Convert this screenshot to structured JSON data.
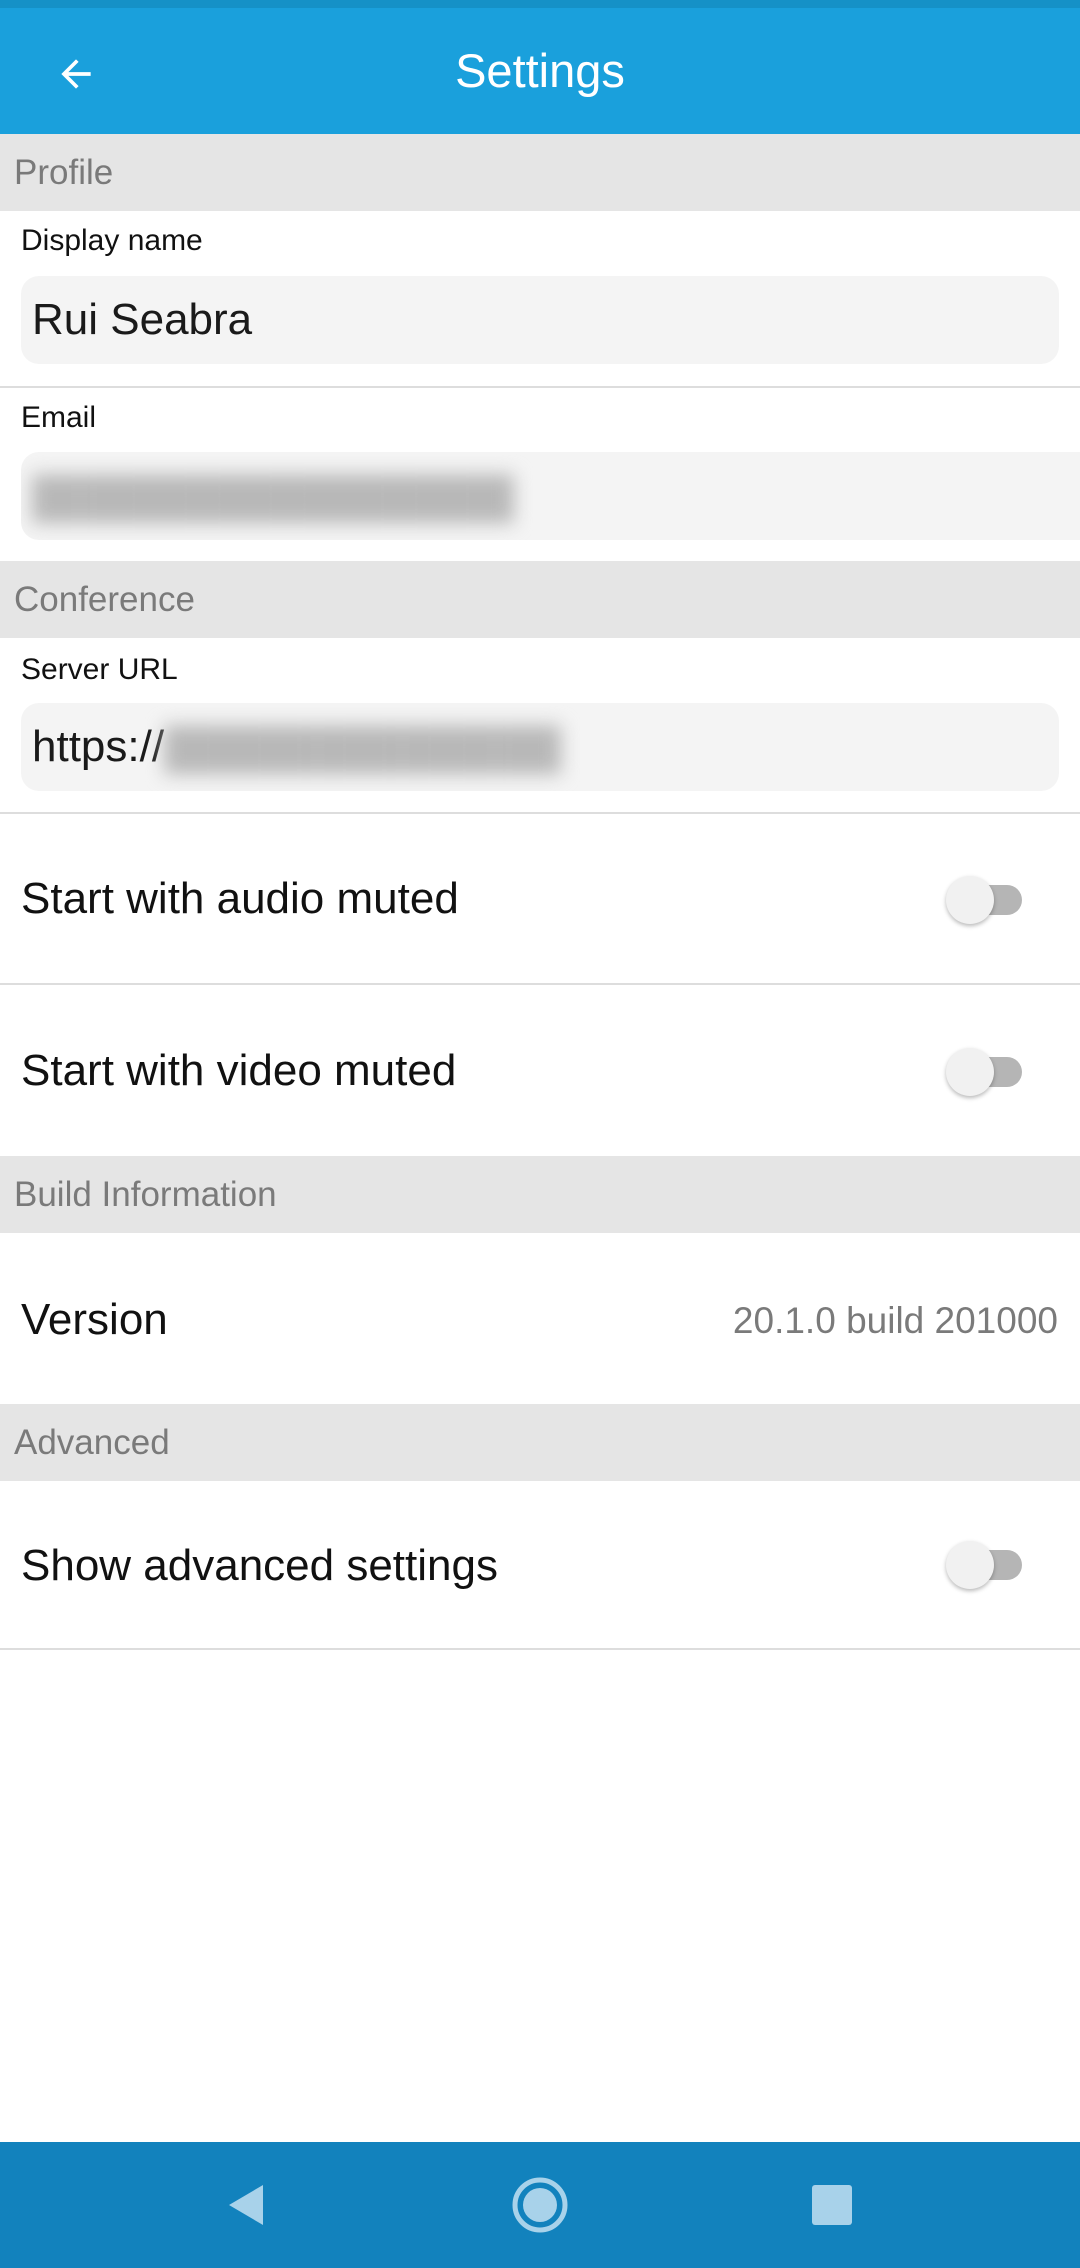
{
  "header": {
    "title": "Settings",
    "back_icon": "arrow-back-icon"
  },
  "sections": {
    "profile": {
      "title": "Profile",
      "display_name_label": "Display name",
      "display_name_value": "Rui Seabra",
      "email_label": "Email",
      "email_value": "(blurred)"
    },
    "conference": {
      "title": "Conference",
      "server_url_label": "Server URL",
      "server_url_value_prefix": "https://",
      "audio_muted_label": "Start with audio muted",
      "audio_muted_on": false,
      "video_muted_label": "Start with video muted",
      "video_muted_on": false
    },
    "build": {
      "title": "Build Information",
      "version_label": "Version",
      "version_value": "20.1.0 build 201000"
    },
    "advanced": {
      "title": "Advanced",
      "show_advanced_label": "Show advanced settings",
      "show_advanced_on": false
    }
  },
  "colors": {
    "app_bar": "#1aa0dc",
    "nav_bar": "#1282bd",
    "section_header_bg": "#e5e5e5"
  },
  "nav_bar": {
    "back_icon": "triangle-back-icon",
    "home_icon": "circle-home-icon",
    "recents_icon": "square-recents-icon"
  }
}
